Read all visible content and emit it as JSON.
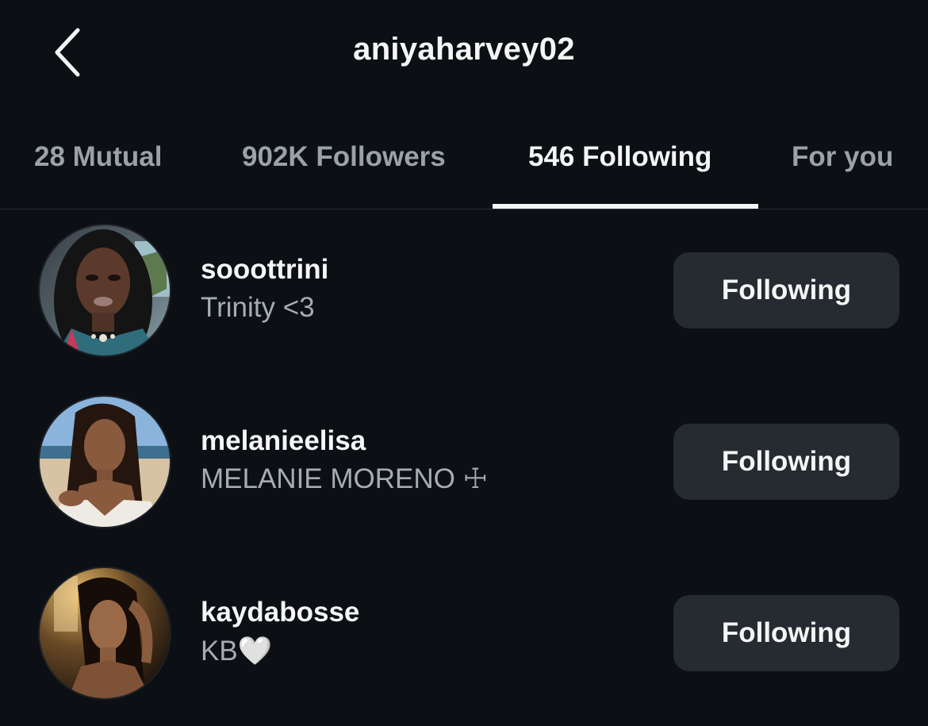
{
  "header": {
    "title": "aniyaharvey02",
    "back_icon": "chevron-left-icon"
  },
  "tabs": [
    {
      "label": "28 Mutual",
      "active": false
    },
    {
      "label": "902K Followers",
      "active": false
    },
    {
      "label": "546 Following",
      "active": true
    },
    {
      "label": "For you",
      "active": false
    }
  ],
  "users": [
    {
      "username": "sooottrini",
      "full_name": "Trinity <3",
      "button_label": "Following",
      "avatar": "profile-photo"
    },
    {
      "username": "melanieelisa",
      "full_name": "MELANIE MORENO ☩",
      "button_label": "Following",
      "avatar": "profile-photo"
    },
    {
      "username": "kaydabosse",
      "full_name": "KB🤍",
      "button_label": "Following",
      "avatar": "profile-photo"
    }
  ],
  "colors": {
    "background": "#0c0f14",
    "button": "#262a31",
    "text_primary": "#f5f5f5",
    "text_secondary": "#a6acb4"
  }
}
